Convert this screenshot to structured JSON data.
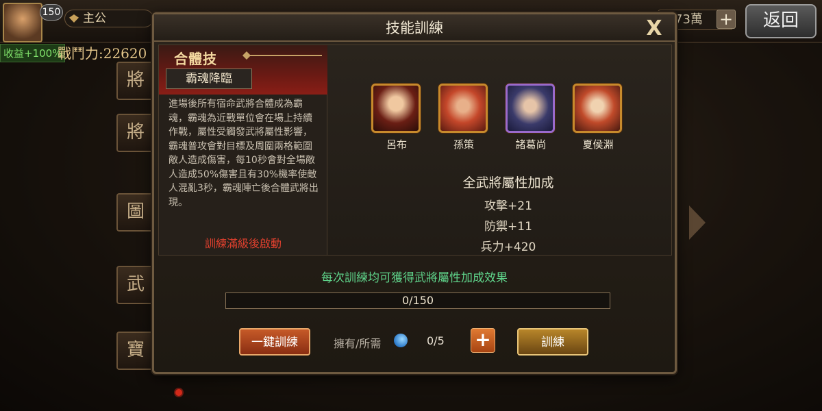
{
  "hud": {
    "level": "150",
    "rank": "主公",
    "bonus": "收益+100%",
    "power": "戰鬥力:22620",
    "gold": "73萬",
    "add": "+",
    "return_label": "返回",
    "side_tabs": [
      "將",
      "將",
      "圖",
      "武",
      "寶"
    ]
  },
  "dialog": {
    "title": "技能訓練",
    "close": "X"
  },
  "skill": {
    "type": "合體技",
    "name": "霸魂降臨",
    "description": "進場後所有宿命武將合體成為霸魂，霸魂為近戰單位會在場上持續作戰，屬性受觸發武將屬性影響，霸魂普攻會對目標及周圍兩格範圍敵人造成傷害，每10秒會對全場敵人造成50%傷害且有30%機率使敵人混亂3秒，霸魂陣亡後合體武將出現。",
    "note": "訓練滿級後啟動"
  },
  "heroes": [
    {
      "name": "呂布"
    },
    {
      "name": "孫策"
    },
    {
      "name": "諸葛尚"
    },
    {
      "name": "夏侯淵"
    }
  ],
  "bonus": {
    "title": "全武將屬性加成",
    "stats": [
      "攻擊+21",
      "防禦+11",
      "兵力+420"
    ]
  },
  "training": {
    "tip": "每次訓練均可獲得武將屬性加成效果",
    "progress_text": "0/150",
    "progress_fraction": 0,
    "one_click_label": "一鍵訓練",
    "own_label": "擁有/所需",
    "own_count": "0/5",
    "plus": "+",
    "train_label": "訓練"
  }
}
